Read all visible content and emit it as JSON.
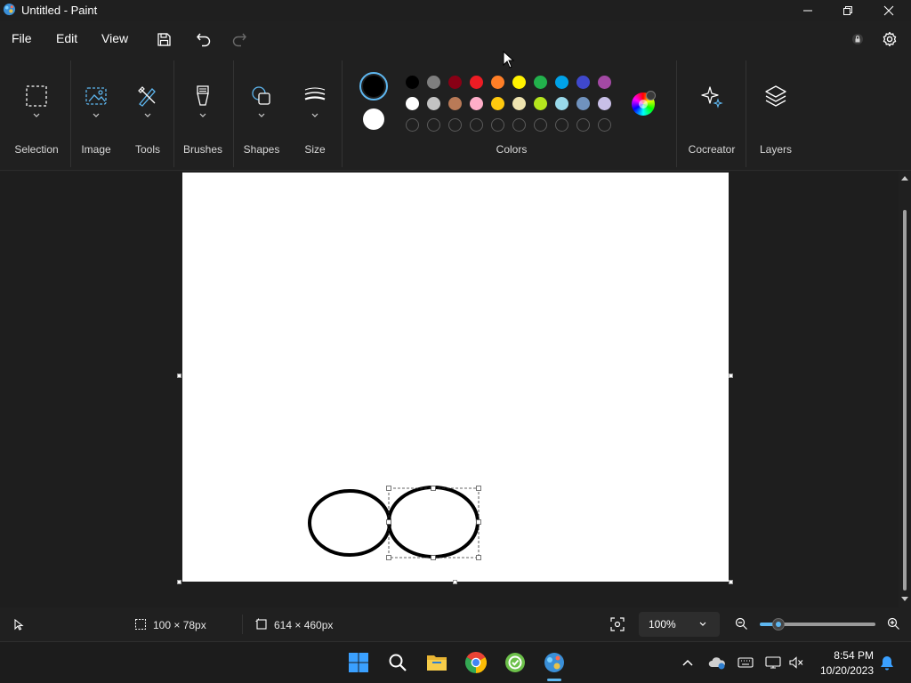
{
  "window": {
    "title": "Untitled - Paint"
  },
  "menu": {
    "file": "File",
    "edit": "Edit",
    "view": "View"
  },
  "ribbon": {
    "selection": "Selection",
    "image": "Image",
    "tools": "Tools",
    "brushes": "Brushes",
    "shapes": "Shapes",
    "size": "Size",
    "colors": "Colors",
    "cocreator": "Cocreator",
    "layers": "Layers"
  },
  "colors": {
    "primary": "#000000",
    "secondary": "#ffffff",
    "palette_row1": [
      "#000000",
      "#7f7f7f",
      "#880015",
      "#ed1c24",
      "#ff7f27",
      "#fff200",
      "#22b14c",
      "#00a2e8",
      "#3f48cc",
      "#a349a4"
    ],
    "palette_row2": [
      "#ffffff",
      "#c3c3c3",
      "#b97a57",
      "#ffaec9",
      "#ffc90e",
      "#efe4b0",
      "#b5e61d",
      "#99d9ea",
      "#7092be",
      "#c8bfe7"
    ],
    "custom_slots": 10
  },
  "status": {
    "selection_size": "100 × 78px",
    "canvas_size": "614 × 460px",
    "zoom": "100%"
  },
  "taskbar": {
    "time": "8:54 PM",
    "date": "10/20/2023"
  }
}
